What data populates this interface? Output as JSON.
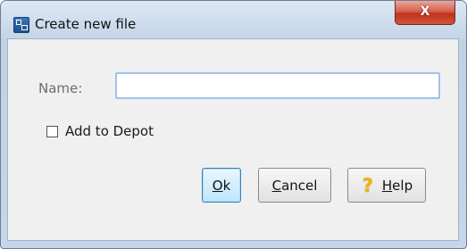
{
  "window": {
    "title": "Create new file",
    "close_label": "X"
  },
  "form": {
    "name_label": "Name:",
    "name_value": "",
    "add_to_depot_label": "Add to Depot",
    "add_to_depot_checked": false
  },
  "buttons": {
    "ok_mnemonic": "O",
    "ok_rest": "k",
    "cancel_mnemonic": "C",
    "cancel_rest": "ancel",
    "help_mnemonic": "H",
    "help_rest": "elp"
  },
  "icons": {
    "app": "app-icon",
    "close": "close-icon",
    "help": "help-icon"
  }
}
